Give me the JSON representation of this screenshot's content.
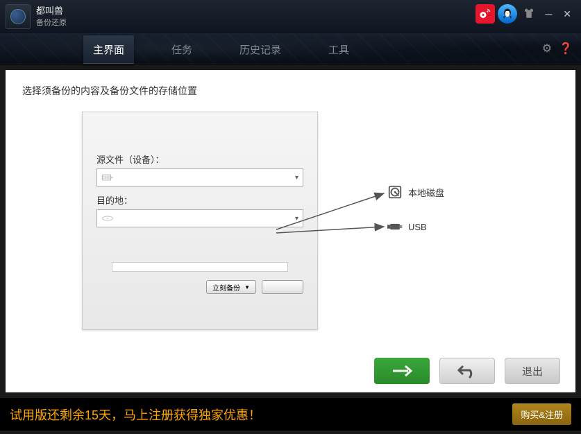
{
  "app": {
    "name": "都叫兽",
    "subtitle": "备份还原"
  },
  "tabs": {
    "main": "主界面",
    "tasks": "任务",
    "history": "历史记录",
    "tools": "工具"
  },
  "content": {
    "title": "选择须备份的内容及备份文件的存储位置",
    "source_label": "源文件（设备）：",
    "dest_label": "目的地：",
    "backup_now": "立刻备份"
  },
  "annotations": {
    "local_disk": "本地磁盘",
    "usb": "USB"
  },
  "footer": {
    "exit": "退出"
  },
  "trial": {
    "message": "试用版还剩余15天，马上注册获得独家优惠！",
    "buy": "购买&注册"
  }
}
